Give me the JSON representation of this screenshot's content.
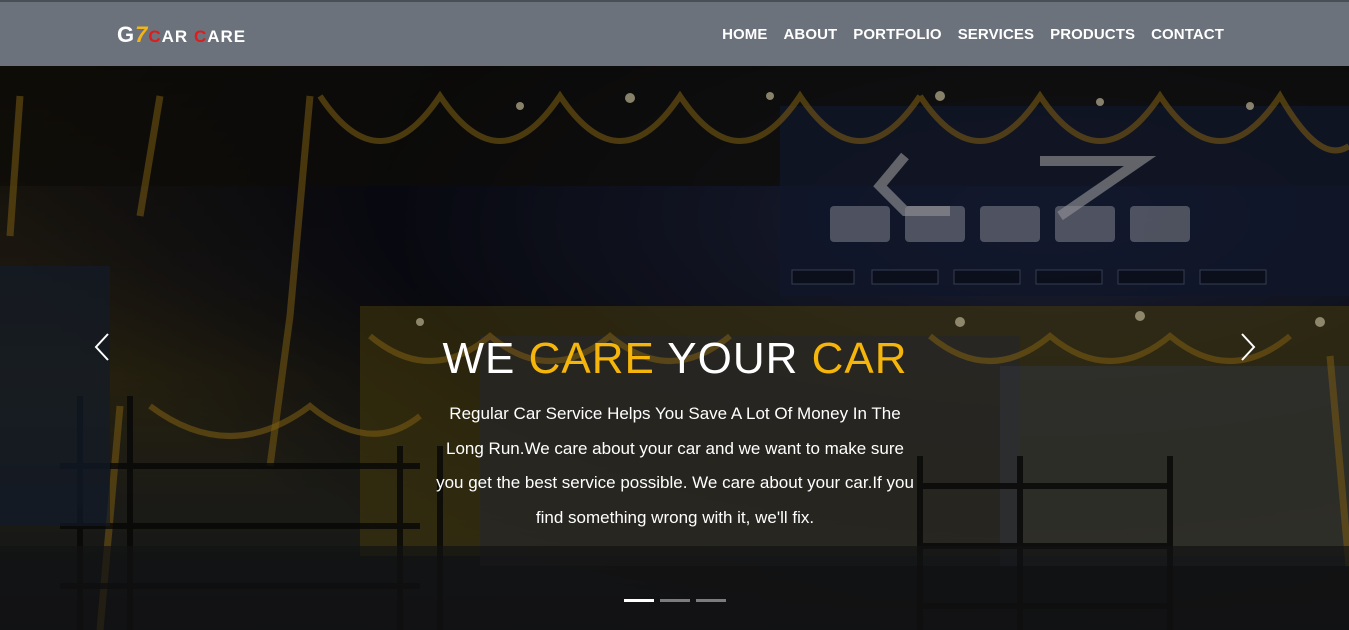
{
  "brand": {
    "g": "G",
    "seven": "7",
    "car_c": "C",
    "car_rest": "AR ",
    "care_c": "C",
    "care_rest": "ARE"
  },
  "nav": {
    "items": [
      {
        "label": "HOME"
      },
      {
        "label": "ABOUT"
      },
      {
        "label": "PORTFOLIO"
      },
      {
        "label": "SERVICES"
      },
      {
        "label": "PRODUCTS"
      },
      {
        "label": "CONTACT"
      }
    ]
  },
  "hero": {
    "headline": {
      "w1": "WE ",
      "w2": "CARE",
      "w3": " YOUR ",
      "w4": "CAR"
    },
    "subtext": "Regular Car Service Helps You Save A Lot Of Money In The Long Run.We care about your car and we want to make sure you get the best service possible. We care about your car.If you find something wrong with it, we'll fix.",
    "slide_count": 3,
    "active_slide": 1
  },
  "icons": {
    "prev": "chevron-left-icon",
    "next": "chevron-right-icon"
  },
  "colors": {
    "navbar": "#6b727b",
    "accent_gold": "#f5b50a",
    "logo_red": "#e01b1b"
  }
}
